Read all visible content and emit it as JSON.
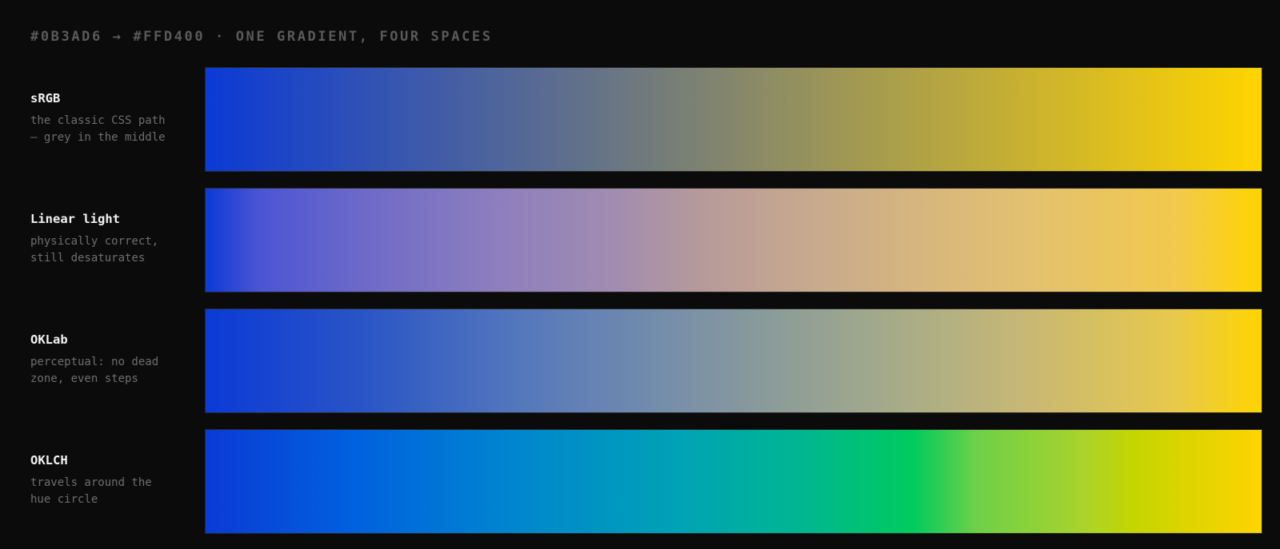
{
  "header": {
    "title": "#0B3AD6 → #FFD400 · ONE GRADIENT, FOUR SPACES"
  },
  "colors": {
    "start": "#0B3AD6",
    "end": "#FFD400",
    "background": "#0b0b0b"
  },
  "rows": [
    {
      "name": "sRGB",
      "description": "the classic CSS path\n— grey in the middle"
    },
    {
      "name": "Linear light",
      "description": "physically correct,\nstill desaturates"
    },
    {
      "name": "OKLab",
      "description": "perceptual: no dead\nzone, even steps"
    },
    {
      "name": "OKLCH",
      "description": "travels around the\nhue circle"
    }
  ]
}
